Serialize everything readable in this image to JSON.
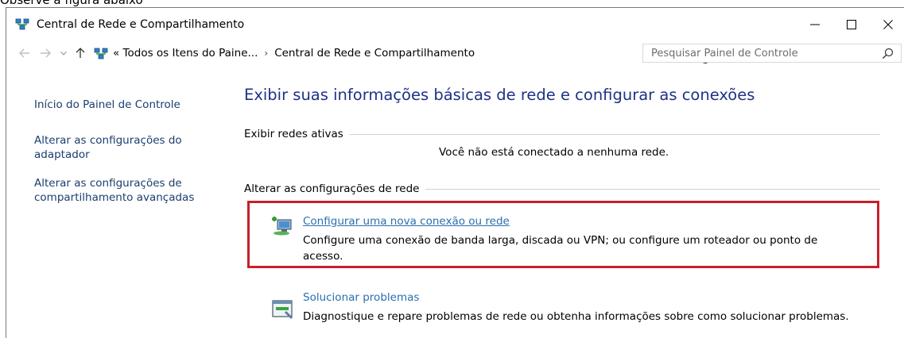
{
  "caption": "Observe a figura abaixo",
  "window": {
    "title": "Central de Rede e Compartilhamento"
  },
  "address": {
    "breadcrumbs": [
      "« Todos os Itens do Paine...",
      "Central de Rede e Compartilhamento"
    ],
    "search_placeholder": "Pesquisar Painel de Controle"
  },
  "left_pane": {
    "home_label": "Início do Painel de Controle",
    "adapter_label": "Alterar as configurações do adaptador",
    "sharing_label": "Alterar as configurações de compartilhamento avançadas"
  },
  "main": {
    "title": "Exibir suas informações básicas de rede e configurar as conexões",
    "active_networks_header": "Exibir redes ativas",
    "not_connected_text": "Você não está conectado a nenhuma rede.",
    "change_settings_header": "Alterar as configurações de rede",
    "tasks": [
      {
        "link": "Configurar uma nova conexão ou rede",
        "description": "Configure uma conexão de banda larga, discada ou VPN; ou configure um roteador ou ponto de acesso."
      },
      {
        "link": "Solucionar problemas",
        "description": "Diagnostique e repare problemas de rede ou obtenha informações sobre como solucionar problemas."
      }
    ]
  },
  "colors": {
    "highlight_border": "#c8202a",
    "title_blue": "#1e3287",
    "link_blue": "#2a6fb0"
  }
}
